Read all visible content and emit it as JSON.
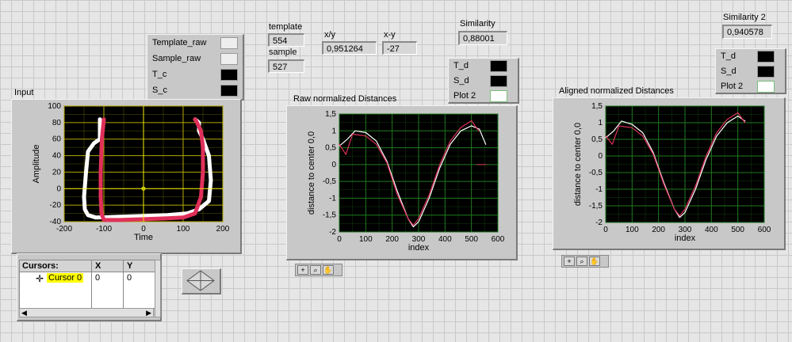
{
  "legend1": {
    "items": [
      {
        "label": "Template_raw",
        "icon": "plot-legend-icon"
      },
      {
        "label": "Sample_raw",
        "icon": "plot-legend-icon"
      },
      {
        "label": "T_c",
        "icon": "plot-legend-icon"
      },
      {
        "label": "S_c",
        "icon": "plot-legend-icon"
      }
    ]
  },
  "indicators": {
    "template": {
      "label": "template",
      "value": "554"
    },
    "sample": {
      "label": "sample",
      "value": "527"
    },
    "xy": {
      "label": "x/y",
      "value": "0,951264"
    },
    "x_minus_y": {
      "label": "x-y",
      "value": "-27"
    },
    "similarity": {
      "label": "Similarity",
      "value": "0,88001"
    },
    "similarity2": {
      "label": "Similarity 2",
      "value": "0,940578"
    }
  },
  "legend2": {
    "items": [
      {
        "label": "T_d"
      },
      {
        "label": "S_d"
      },
      {
        "label": "Plot 2"
      }
    ]
  },
  "legend3": {
    "items": [
      {
        "label": "T_d"
      },
      {
        "label": "S_d"
      },
      {
        "label": "Plot 2"
      }
    ]
  },
  "colors": {
    "plot_bg": "#000000",
    "grid_input": "#b3a800",
    "grid_dist": "#1f7a1f",
    "template": "#ffffff",
    "sample": "#e0305a",
    "cursor": "#ffff00"
  },
  "chart_data": [
    {
      "type": "line",
      "title": "Input",
      "xlabel": "Time",
      "ylabel": "Amplitude",
      "xlim": [
        -200,
        200
      ],
      "ylim": [
        -40,
        100
      ],
      "x_ticks": [
        "-200",
        "-100",
        "0",
        "100",
        "200"
      ],
      "y_ticks": [
        "100",
        "80",
        "60",
        "40",
        "20",
        "0",
        "-20",
        "-40"
      ],
      "series": [
        {
          "name": "Template_raw",
          "x": [
            -110,
            -110,
            -125,
            -140,
            -145,
            -150,
            -148,
            -140,
            -120,
            -60,
            0,
            60,
            110,
            140,
            165,
            170,
            165,
            150,
            140,
            140,
            130
          ],
          "y": [
            84,
            60,
            55,
            45,
            20,
            -10,
            -25,
            -32,
            -35,
            -34,
            -33,
            -32,
            -30,
            -25,
            -15,
            10,
            40,
            60,
            70,
            80,
            84
          ]
        },
        {
          "name": "Sample_raw",
          "x": [
            -100,
            -105,
            -108,
            -108,
            -106,
            -100,
            -60,
            0,
            60,
            100,
            130,
            145,
            150,
            150,
            145,
            135,
            130
          ],
          "y": [
            84,
            60,
            20,
            -10,
            -30,
            -38,
            -38,
            -37,
            -36,
            -35,
            -30,
            -10,
            20,
            50,
            70,
            80,
            84
          ]
        }
      ],
      "cursor": {
        "x": 0,
        "y": 0
      }
    },
    {
      "type": "line",
      "title": "Raw normalized Distances",
      "xlabel": "index",
      "ylabel": "distance to center 0,0",
      "xlim": [
        0,
        600
      ],
      "ylim": [
        -2,
        1.5
      ],
      "x_ticks": [
        "0",
        "100",
        "200",
        "300",
        "400",
        "500",
        "600"
      ],
      "y_ticks": [
        "1,5",
        "1",
        "0,5",
        "0",
        "-0,5",
        "-1",
        "-1,5",
        "-2"
      ],
      "series": [
        {
          "name": "T_d",
          "x": [
            0,
            30,
            60,
            100,
            140,
            180,
            220,
            260,
            280,
            300,
            340,
            380,
            420,
            460,
            500,
            530,
            554
          ],
          "y": [
            0.55,
            0.75,
            1.0,
            0.95,
            0.7,
            0.1,
            -0.8,
            -1.6,
            -1.85,
            -1.7,
            -1.0,
            -0.1,
            0.6,
            1.0,
            1.15,
            1.05,
            0.6
          ]
        },
        {
          "name": "S_d",
          "x": [
            0,
            25,
            50,
            100,
            140,
            180,
            220,
            260,
            280,
            300,
            340,
            380,
            420,
            460,
            500,
            527
          ],
          "y": [
            0.6,
            0.3,
            0.9,
            0.85,
            0.6,
            0.05,
            -0.9,
            -1.6,
            -1.8,
            -1.6,
            -0.9,
            0.0,
            0.7,
            1.1,
            1.3,
            1.0
          ]
        },
        {
          "name": "Plot 2",
          "x": [
            520,
            555
          ],
          "y": [
            0.0,
            0.0
          ]
        }
      ]
    },
    {
      "type": "line",
      "title": "Aligned normalized Distances",
      "xlabel": "index",
      "ylabel": "distance to center 0,0",
      "xlim": [
        0,
        600
      ],
      "ylim": [
        -2,
        1.5
      ],
      "x_ticks": [
        "0",
        "100",
        "200",
        "300",
        "400",
        "500",
        "600"
      ],
      "y_ticks": [
        "1,5",
        "1",
        "0,5",
        "0",
        "-0,5",
        "-1",
        "-1,5",
        "-2"
      ],
      "series": [
        {
          "name": "T_d",
          "x": [
            0,
            30,
            60,
            100,
            140,
            180,
            220,
            260,
            280,
            300,
            340,
            380,
            420,
            460,
            500,
            527
          ],
          "y": [
            0.55,
            0.75,
            1.05,
            0.95,
            0.7,
            0.1,
            -0.8,
            -1.6,
            -1.85,
            -1.7,
            -1.0,
            -0.1,
            0.6,
            1.0,
            1.2,
            1.05
          ]
        },
        {
          "name": "S_d",
          "x": [
            0,
            25,
            50,
            100,
            140,
            180,
            220,
            260,
            280,
            300,
            340,
            380,
            420,
            460,
            500,
            527
          ],
          "y": [
            0.6,
            0.35,
            0.9,
            0.85,
            0.6,
            0.05,
            -0.85,
            -1.6,
            -1.8,
            -1.6,
            -0.9,
            0.0,
            0.7,
            1.1,
            1.3,
            1.0
          ]
        }
      ]
    }
  ],
  "cursors_table": {
    "headers": [
      "Cursors:",
      "X",
      "Y"
    ],
    "rows": [
      {
        "name": "Cursor 0",
        "x": "0",
        "y": "0"
      }
    ]
  }
}
